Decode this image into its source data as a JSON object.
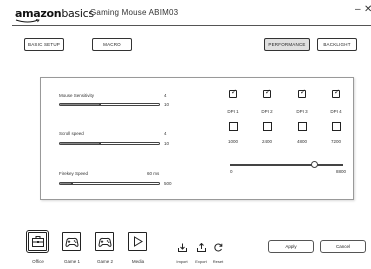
{
  "header": {
    "logo_brand": "amazon",
    "logo_product": "basics",
    "app_title": "Gaming Mouse ABIM03",
    "minimize": "–",
    "close": "✕"
  },
  "tabs": {
    "basic_setup": "BASIC SETUP",
    "macro": "MACRO",
    "performance": "PERFORMANCE",
    "backlight": "BACKLIGHT",
    "active": "PERFORMANCE"
  },
  "settings": {
    "mouse_sensitivity": {
      "label": "Mouse Sensitivity",
      "value": "4",
      "max": "10",
      "level": 0.4
    },
    "scroll_speed": {
      "label": "Scroll speed",
      "value": "4",
      "max": "10",
      "level": 0.4
    },
    "firekey_speed": {
      "label": "Firekey Speed",
      "value": "60 ms",
      "max": "500",
      "level": 0.12
    }
  },
  "dpi": {
    "stages": [
      {
        "label": "DPI 1",
        "enabled": true,
        "value": "1000"
      },
      {
        "label": "DPI 2",
        "enabled": true,
        "value": "2400"
      },
      {
        "label": "DPI 3",
        "enabled": true,
        "value": "4800"
      },
      {
        "label": "DPI 4",
        "enabled": true,
        "value": "7200"
      }
    ],
    "range_min": "0",
    "range_max": "8800",
    "slider_level": 0.75,
    "check_mark": "✓"
  },
  "profiles": [
    {
      "label": "Office",
      "icon": "briefcase-icon",
      "selected": true
    },
    {
      "label": "Game 1",
      "icon": "gamepad-icon",
      "selected": false
    },
    {
      "label": "Game 2",
      "icon": "gamepad-icon",
      "selected": false
    },
    {
      "label": "Media",
      "icon": "play-icon",
      "selected": false
    }
  ],
  "actions": {
    "import": "Import",
    "export": "Export",
    "reset": "Reset"
  },
  "footer": {
    "apply": "Apply",
    "cancel": "Cancel"
  }
}
